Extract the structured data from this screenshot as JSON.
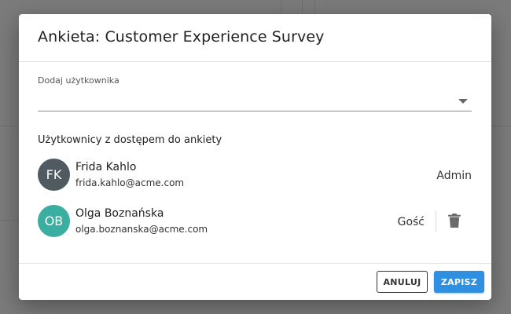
{
  "dialog": {
    "title": "Ankieta: Customer Experience Survey",
    "add_user": {
      "label": "Dodaj użytkownika",
      "value": "",
      "placeholder": ""
    },
    "section_title": "Użytkownicy z dostępem do ankiety",
    "users": [
      {
        "initials": "FK",
        "name": "Frida Kahlo",
        "email": "frida.kahlo@acme.com",
        "role": "Admin",
        "avatar_color": "#4f5a61"
      },
      {
        "initials": "OB",
        "name": "Olga Boznańska",
        "email": "olga.boznanska@acme.com",
        "role": "Gość",
        "avatar_color": "#3aaea0"
      }
    ],
    "buttons": {
      "cancel": "ANULUJ",
      "save": "ZAPISZ"
    },
    "colors": {
      "accent": "#2f8fe0"
    },
    "icons": {
      "dropdown": "chevron-down-icon",
      "delete": "trash-icon"
    }
  }
}
